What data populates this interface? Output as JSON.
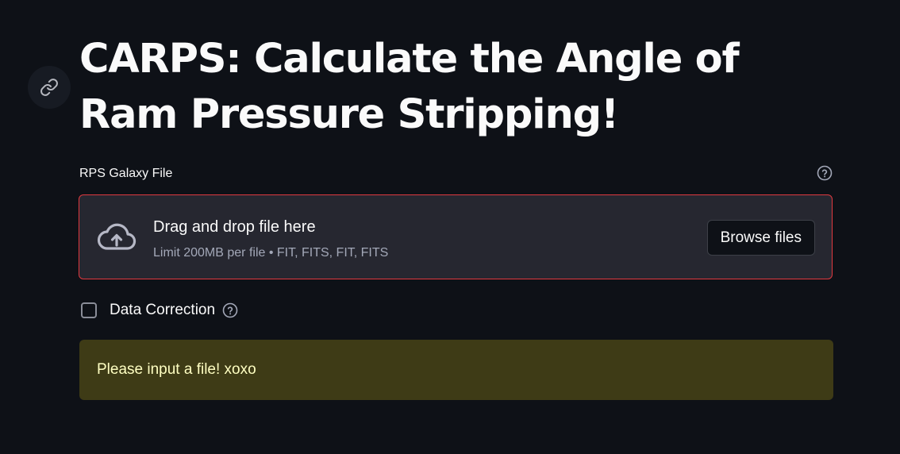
{
  "header": {
    "title": "CARPS: Calculate the Angle of Ram Pressure Stripping!",
    "anchor_icon": "link-icon"
  },
  "uploader": {
    "label": "RPS Galaxy File",
    "help_icon": "help-circle-icon",
    "drop_title": "Drag and drop file here",
    "drop_limit": "Limit 200MB per file • FIT, FITS, FIT, FITS",
    "browse_label": "Browse files",
    "upload_icon": "cloud-upload-icon",
    "border_color": "#e0393f"
  },
  "data_correction": {
    "label": "Data Correction",
    "checked": false,
    "help_icon": "help-circle-icon"
  },
  "warning": {
    "text": "Please input a file! xoxo",
    "background": "#3e3b16",
    "text_color": "#ffffc2"
  },
  "theme": {
    "background": "#0e1117",
    "dropzone_background": "#262730"
  }
}
